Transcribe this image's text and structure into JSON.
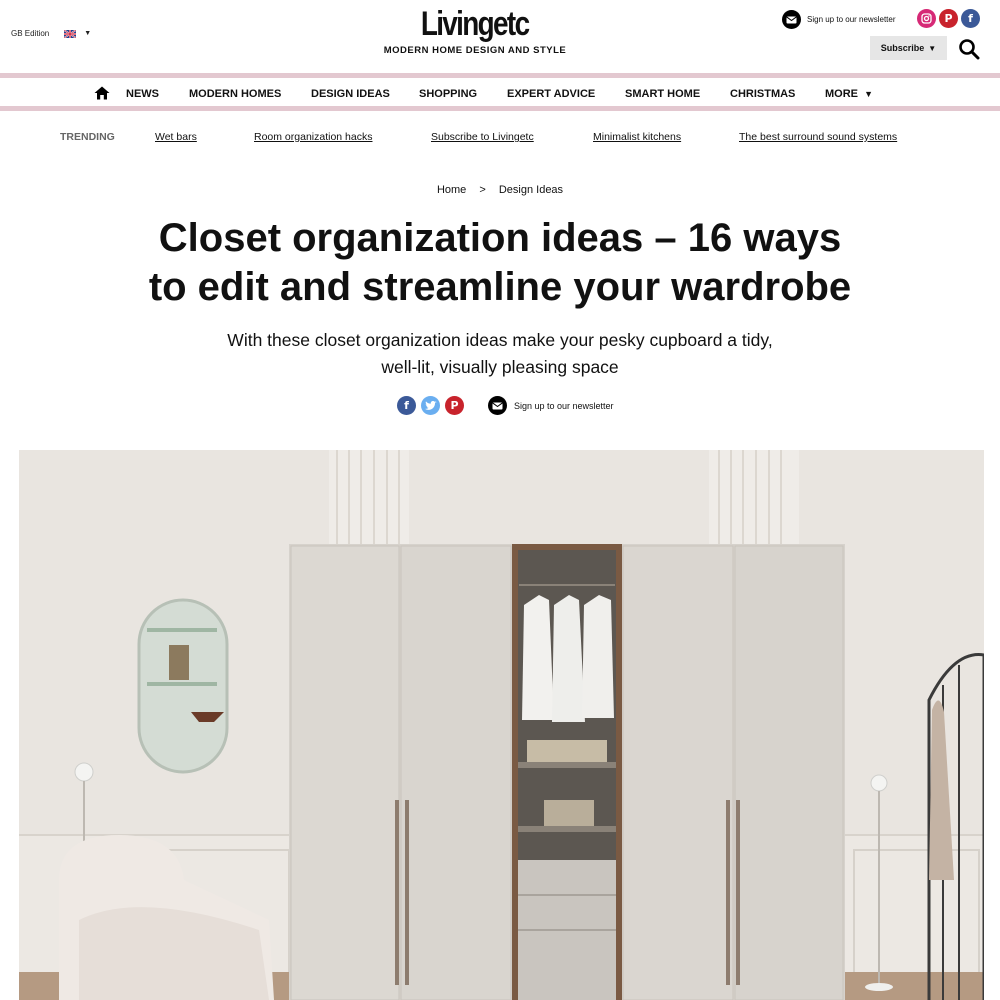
{
  "header": {
    "edition_label": "GB Edition",
    "logo_text": "Livingetc",
    "tagline": "MODERN HOME DESIGN AND STYLE",
    "newsletter_text": "Sign up to our newsletter",
    "subscribe_label": "Subscribe",
    "social_icons": [
      "instagram-icon",
      "pinterest-icon",
      "facebook-icon"
    ]
  },
  "nav": {
    "items": [
      "NEWS",
      "MODERN HOMES",
      "DESIGN IDEAS",
      "SHOPPING",
      "EXPERT ADVICE",
      "SMART HOME",
      "CHRISTMAS",
      "MORE"
    ]
  },
  "trending": {
    "label": "TRENDING",
    "links": [
      "Wet bars",
      "Room organization hacks",
      "Subscribe to Livingetc",
      "Minimalist kitchens",
      "The best surround sound systems"
    ]
  },
  "article": {
    "breadcrumb": [
      "Home",
      ">",
      "Design Ideas"
    ],
    "title_line1": "Closet organization ideas – 16 ways",
    "title_line2": "to edit and streamline your wardrobe",
    "subtitle_line1": "With these closet organization ideas make your pesky cupboard a tidy,",
    "subtitle_line2": "well-lit, visually pleasing space",
    "share_newsletter_text": "Sign up to our newsletter"
  },
  "colors": {
    "nav_border": "#e3c8d0",
    "instagram": "#d62976",
    "pinterest": "#c8232c",
    "facebook": "#3b5998",
    "twitter": "#6aaef0"
  }
}
